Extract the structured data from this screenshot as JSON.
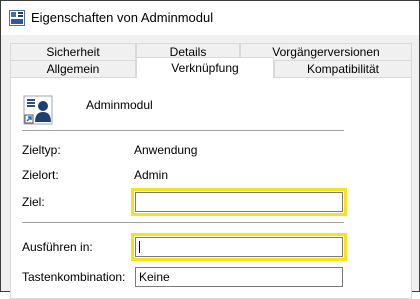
{
  "window": {
    "title": "Eigenschaften von Adminmodul",
    "app_icon": "shortcut-properties-icon"
  },
  "tabs": {
    "row_back": [
      "Sicherheit",
      "Details",
      "Vorgängerversionen"
    ],
    "row_front": [
      "Allgemein",
      "Verknüpfung",
      "Kompatibilität"
    ],
    "active": "Verknüpfung"
  },
  "shortcut": {
    "name": "Adminmodul",
    "icon": "admin-module-icon"
  },
  "fields": {
    "zieltyp_label": "Zieltyp:",
    "zieltyp_value": "Anwendung",
    "zielort_label": "Zielort:",
    "zielort_value": "Admin",
    "ziel_label": "Ziel:",
    "ziel_value": "",
    "ausfuehren_label": "Ausführen in:",
    "ausfuehren_value": "",
    "tasten_label": "Tastenkombination:",
    "tasten_value": "Keine"
  },
  "colors": {
    "highlight": "#f7e31a",
    "window_bg": "#f0f0f0",
    "panel_bg": "#ffffff"
  }
}
